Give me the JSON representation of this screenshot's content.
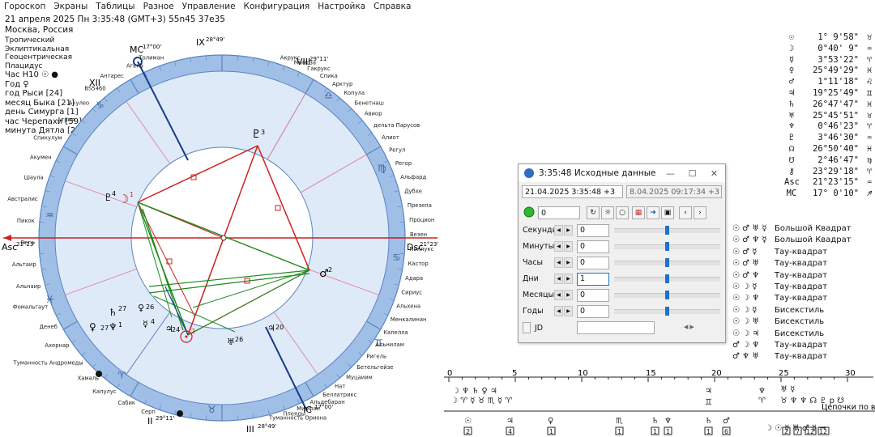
{
  "menu": [
    "Гороскоп",
    "Экраны",
    "Таблицы",
    "Разное",
    "Управление",
    "Конфигурация",
    "Настройка",
    "Справка"
  ],
  "header": {
    "datetime": "21 апреля 2025  Пн   3:35:48 (GMT+3) 55n45  37e35",
    "place": "Москва, Россия"
  },
  "params": [
    "Тропический",
    "Эклиптикальная",
    "Геоцентрическая",
    "Плацидус"
  ],
  "params2": [
    "Час Н10 ☉ ●",
    "Год ♀",
    "год Рыси [24]",
    "месяц Быка [21]",
    "день Симурга [1]",
    "час Черепахи [59]",
    "минута Дятла [27]"
  ],
  "chart": {
    "asc_label": "Asc",
    "asc_deg": "21°23'",
    "dsc_label": "Dsc",
    "dsc_deg": "21°23'",
    "mc_label": "MC",
    "mc_deg": "17°00'",
    "ic_label": "IC",
    "ic_deg": "17°00'",
    "cusps": [
      {
        "n": "IX",
        "deg": "28°49'"
      },
      {
        "n": "VIII",
        "deg": "29°11'"
      },
      {
        "n": "XII",
        "deg": "29°11'"
      },
      {
        "n": "II",
        "deg": "29°11'"
      },
      {
        "n": "III",
        "deg": "28°49'"
      }
    ],
    "stars_right": [
      "Акрукс",
      "Мимоза",
      "Гакрукс",
      "Спика",
      "Арктур",
      "Копула",
      "Бенетнаш",
      "Авиор",
      "дельта Парусов",
      "Алиот",
      "Регул",
      "Регор",
      "Альфард",
      "Дубхе",
      "Презепа",
      "Процион",
      "Везен",
      "Поллукс",
      "Кастор",
      "Адара",
      "Сириус",
      "Альхена",
      "Менкалинан",
      "Капелла",
      "Альнилам",
      "Ригель",
      "Бетельгейзе",
      "Муцаиим",
      "Нат",
      "Беллатрикс",
      "Альдебаран",
      "Мирфак",
      "Плеяды",
      "Туманность Ориона"
    ],
    "stars_left": [
      "Толиман",
      "Агена",
      "Антарес",
      "BS5460",
      "Акулео",
      "Атрия",
      "Спикулум",
      "Акумен",
      "Шаула",
      "Австралис",
      "Пикок",
      "Вега",
      "Альтаир",
      "Альнаир",
      "Фомальгаут",
      "Денеб",
      "Ахернар",
      "Туманность Андромеды",
      "Хамаль",
      "Капулус",
      "Сабик",
      "Серп"
    ]
  },
  "planets": [
    {
      "glyph": "☉",
      "value": "1° 9'58\"",
      "sign": "♉"
    },
    {
      "glyph": "☽",
      "value": "0°40' 9\"",
      "sign": "♒"
    },
    {
      "glyph": "☿",
      "value": "3°53'22\"",
      "sign": "♈"
    },
    {
      "glyph": "♀",
      "value": "25°49'29\"",
      "sign": "♓"
    },
    {
      "glyph": "♂",
      "value": "1°11'18\"",
      "sign": "♌"
    },
    {
      "glyph": "♃",
      "value": "19°25'49\"",
      "sign": "♊"
    },
    {
      "glyph": "♄",
      "value": "26°47'47\"",
      "sign": "♓"
    },
    {
      "glyph": "♅",
      "value": "25°45'51\"",
      "sign": "♉"
    },
    {
      "glyph": "♆",
      "value": "0°46'23\"",
      "sign": "♈"
    },
    {
      "glyph": "♇",
      "value": "3°46'30\"",
      "sign": "♒"
    },
    {
      "glyph": "☊",
      "value": "26°50'40\"",
      "sign": "♓"
    },
    {
      "glyph": "☋",
      "value": "2°46'47\"",
      "sign": "♍"
    },
    {
      "glyph": "⚷",
      "value": "23°29'18\"",
      "sign": "♈"
    },
    {
      "glyph": "Asc",
      "value": "21°23'15\"",
      "sign": "♒"
    },
    {
      "glyph": "MC",
      "value": "17° 0'10\"",
      "sign": "♐"
    }
  ],
  "aspects": [
    {
      "glyphs": "☉ ♂ ♅ ☿",
      "label": "Большой Квадрат"
    },
    {
      "glyphs": "☉ ♂ ♆ ☿",
      "label": "Большой Квадрат"
    },
    {
      "glyphs": "☉ ♂ ☿",
      "label": "Тау-квадрат"
    },
    {
      "glyphs": "☉ ♂ ♅",
      "label": "Тау-квадрат"
    },
    {
      "glyphs": "☉ ♂ ♆",
      "label": "Тау-квадрат"
    },
    {
      "glyphs": "☉ ☽ ☿",
      "label": "Тау-квадрат"
    },
    {
      "glyphs": "☉ ☽ ♆",
      "label": "Тау-квадрат"
    },
    {
      "glyphs": "☉ ☽ ☿",
      "label": "Бисекстиль"
    },
    {
      "glyphs": "☉ ☽ ♅",
      "label": "Бисекстиль"
    },
    {
      "glyphs": "☉ ☽ ♃",
      "label": "Бисекстиль"
    },
    {
      "glyphs": "♂ ☽ ♆",
      "label": "Тау-квадрат"
    },
    {
      "glyphs": "♂ ♆ ♅",
      "label": "Тау-квадрат"
    }
  ],
  "dialog": {
    "title": "3:35:48 Исходные данные",
    "main_value": "21.04.2025  3:35:48  +3",
    "secondary_value": "8.04.2025  09:17:34 +3",
    "step_value": "0",
    "jd_label": "JD",
    "jd_value": "",
    "fields": [
      {
        "label": "Секунды",
        "value": "0"
      },
      {
        "label": "Минуты",
        "value": "0"
      },
      {
        "label": "Часы",
        "value": "0"
      },
      {
        "label": "Дни",
        "value": "1"
      },
      {
        "label": "Месяцы",
        "value": "0"
      },
      {
        "label": "Годы",
        "value": "0"
      }
    ]
  },
  "timeline": {
    "ticks": [
      "0",
      "5",
      "10",
      "15",
      "20",
      "25",
      "30"
    ],
    "chain_label": "Цепочки по владени",
    "boxes": [
      "2",
      "4",
      "1",
      "1",
      "1",
      "1",
      "1",
      "6",
      "2",
      "7",
      "12",
      "12"
    ]
  }
}
